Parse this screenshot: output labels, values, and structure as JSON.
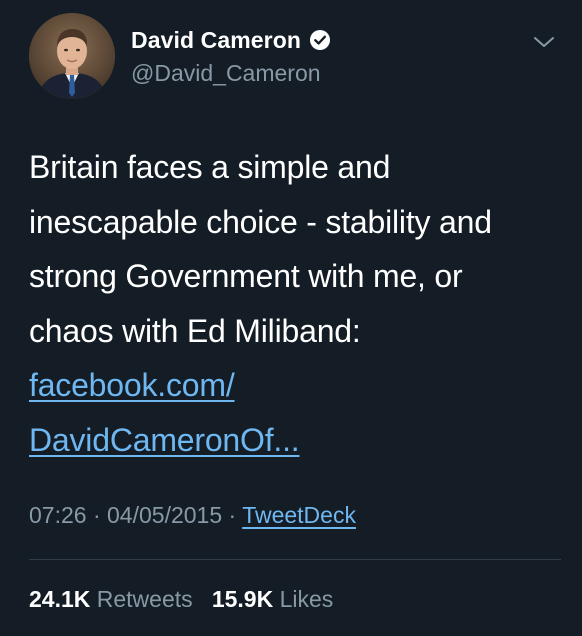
{
  "author": {
    "display_name": "David Cameron",
    "handle": "@David_Cameron",
    "verified": true,
    "avatar_icon": "profile-photo"
  },
  "tweet": {
    "text_lines": [
      "Britain faces a simple and",
      "inescapable choice - stability and",
      "strong Government with me, or",
      "chaos with Ed Miliband:"
    ],
    "link_lines": [
      "facebook.com/",
      "DavidCameronOf..."
    ]
  },
  "meta": {
    "time": "07:26",
    "separator": "·",
    "date": "04/05/2015",
    "source": "TweetDeck"
  },
  "stats": {
    "retweets_count": "24.1K",
    "retweets_label": "Retweets",
    "likes_count": "15.9K",
    "likes_label": "Likes"
  },
  "icons": {
    "verified": "verified-badge-icon",
    "menu": "chevron-down-icon"
  },
  "colors": {
    "background": "#141d26",
    "link": "#6fb7f0",
    "secondary_text": "#8899a6",
    "divider": "#2f3d4b"
  }
}
